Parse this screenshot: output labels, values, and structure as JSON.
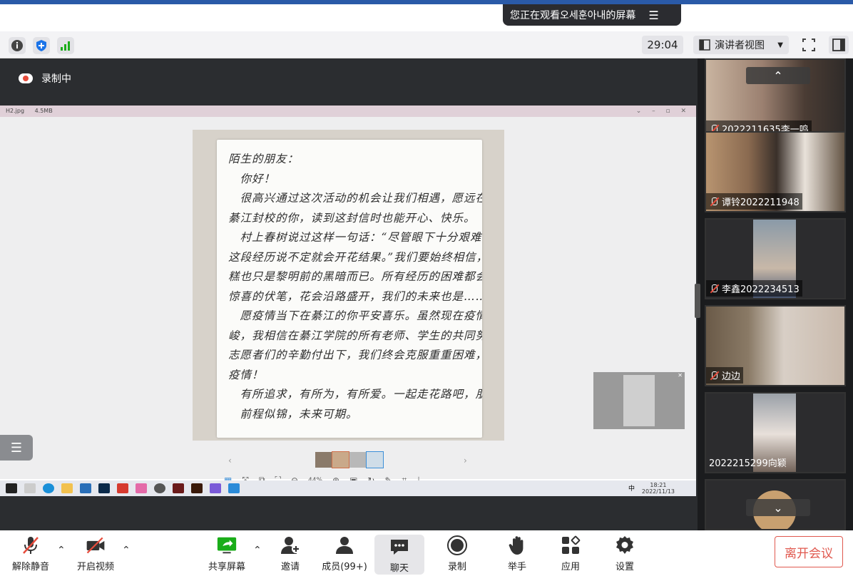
{
  "banner": {
    "watching_text": "您正在观看오세훈아내的屏幕"
  },
  "toolrow": {
    "timer": "29:04",
    "view_label": "演讲者视图"
  },
  "stage": {
    "recording_label": "录制中"
  },
  "viewer": {
    "filename": "H2.jpg",
    "filesize": "4.5MB",
    "zoom": "44%",
    "letter_lines": [
      "陌生的朋友：",
      "　你好！",
      "　很高兴通过这次活动的机会让我们相遇，愿远在",
      "綦江封校的你，读到这封信时也能开心、快乐。",
      "　村上春树说过这样一句话：“尽管眼下十分艰难，可日后",
      "这段经历说不定就会开花结果。”我们要始终相信，当下的糟",
      "糕也只是黎明前的黑暗而已。所有经历的困难都会是未来",
      "惊喜的伏笔，花会沿路盛开，我们的未来也是……",
      "　愿疫情当下在綦江的你平安喜乐。虽然现在疫情十分严",
      "峻，我相信在綦江学院的所有老师、学生的共同努力下，",
      "志愿者们的辛勤付出下，我们终会克服重重困难，战胜",
      "疫情！",
      "　有所追求，有所为，有所爱。一起走花路吧，朋友。",
      "　前程似锦，未来可期。"
    ],
    "clock_time": "18:21",
    "clock_date": "2022/11/13",
    "tray_ime": "中"
  },
  "participants": [
    {
      "name": "2022211635李一鸣",
      "muted": true
    },
    {
      "name": "谭铃2022211948",
      "muted": true
    },
    {
      "name": "李鑫2022234513",
      "muted": true
    },
    {
      "name": "边边",
      "muted": true
    },
    {
      "name": "2022215299向颖",
      "muted": false
    }
  ],
  "toolbar": {
    "unmute": "解除静音",
    "start_video": "开启视频",
    "share_screen": "共享屏幕",
    "invite": "邀请",
    "members": "成员(99+)",
    "chat": "聊天",
    "record": "录制",
    "raise_hand": "举手",
    "apps": "应用",
    "settings": "设置",
    "leave": "离开会议"
  },
  "colors": {
    "accent_green": "#1aad19",
    "leave_red": "#e0584e",
    "mute_red": "#e74c3c",
    "shield_blue": "#1a73e8"
  }
}
